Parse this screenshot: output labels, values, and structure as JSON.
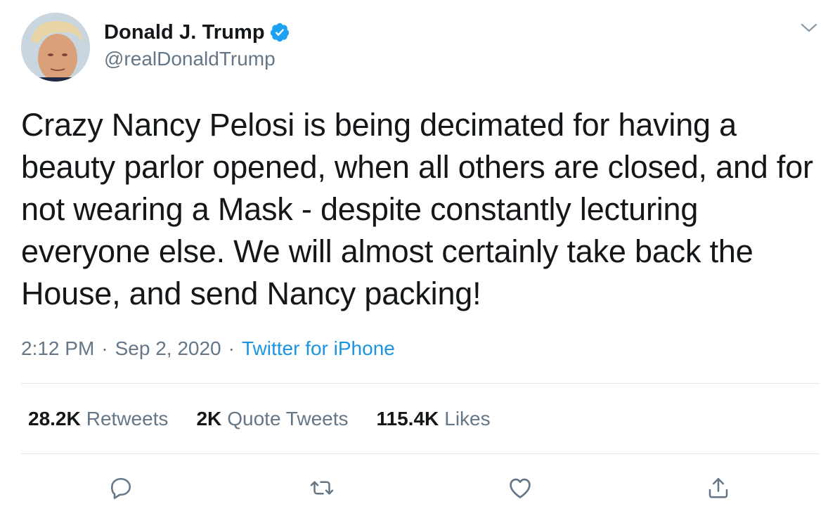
{
  "author": {
    "display_name": "Donald J. Trump",
    "handle": "@realDonaldTrump",
    "verified": true,
    "avatar_icon": "profile-photo"
  },
  "tweet": {
    "text": "Crazy Nancy Pelosi is being decimated for having a beauty parlor opened, when all others are closed, and for not wearing a Mask - despite constantly lecturing everyone else. We will almost certainly take back the House, and send Nancy packing!",
    "time": "2:12 PM",
    "separator": "·",
    "date": "Sep 2, 2020",
    "source": "Twitter for iPhone"
  },
  "stats": {
    "retweets": {
      "count": "28.2K",
      "label": "Retweets"
    },
    "quote_tweets": {
      "count": "2K",
      "label": "Quote Tweets"
    },
    "likes": {
      "count": "115.4K",
      "label": "Likes"
    }
  },
  "actions": {
    "reply_icon": "reply-icon",
    "retweet_icon": "retweet-icon",
    "like_icon": "heart-icon",
    "share_icon": "share-icon",
    "more_icon": "chevron-down-icon"
  },
  "colors": {
    "text_primary": "#14171a",
    "text_secondary": "#657786",
    "link": "#1b95e0",
    "verified": "#1da1f2",
    "divider": "#e1e8ed"
  }
}
